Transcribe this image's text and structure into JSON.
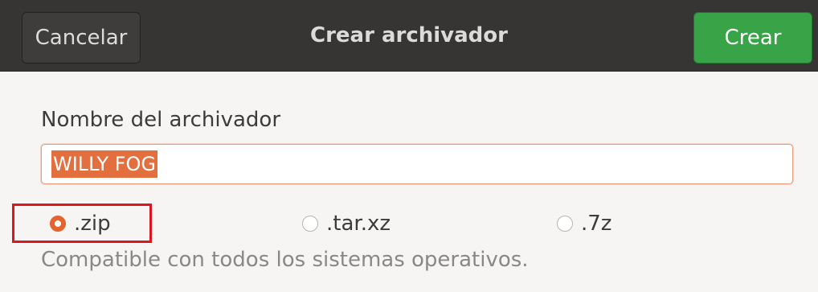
{
  "header": {
    "cancel_label": "Cancelar",
    "title": "Crear archivador",
    "create_label": "Crear"
  },
  "form": {
    "name_label": "Nombre del archivador",
    "name_value": "WILLY FOG",
    "formats": [
      {
        "label": ".zip",
        "selected": true
      },
      {
        "label": ".tar.xz",
        "selected": false
      },
      {
        "label": ".7z",
        "selected": false
      }
    ],
    "hint": "Compatible con todos los sistemas operativos."
  },
  "colors": {
    "headerbar": "#373534",
    "create_button": "#38a447",
    "accent": "#e3642e",
    "annotation_box": "#d9171c"
  }
}
